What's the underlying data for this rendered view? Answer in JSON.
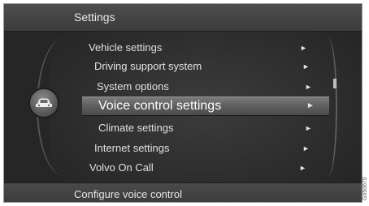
{
  "header": {
    "title": "Settings"
  },
  "menu": {
    "items": [
      {
        "label": "Vehicle settings",
        "selected": false
      },
      {
        "label": "Driving support system",
        "selected": false
      },
      {
        "label": "System options",
        "selected": false
      },
      {
        "label": "Voice control settings",
        "selected": true
      },
      {
        "label": "Climate settings",
        "selected": false
      },
      {
        "label": "Internet settings",
        "selected": false
      },
      {
        "label": "Volvo On Call",
        "selected": false
      }
    ],
    "submenu_arrow": "►"
  },
  "footer": {
    "text": "Configure voice control"
  },
  "side_badge": {
    "icon": "car-icon"
  },
  "image_code": "G050670",
  "colors": {
    "background": "#2c2c2c",
    "selected_row": "#6a6a6a",
    "text": "#e0e0e0"
  }
}
